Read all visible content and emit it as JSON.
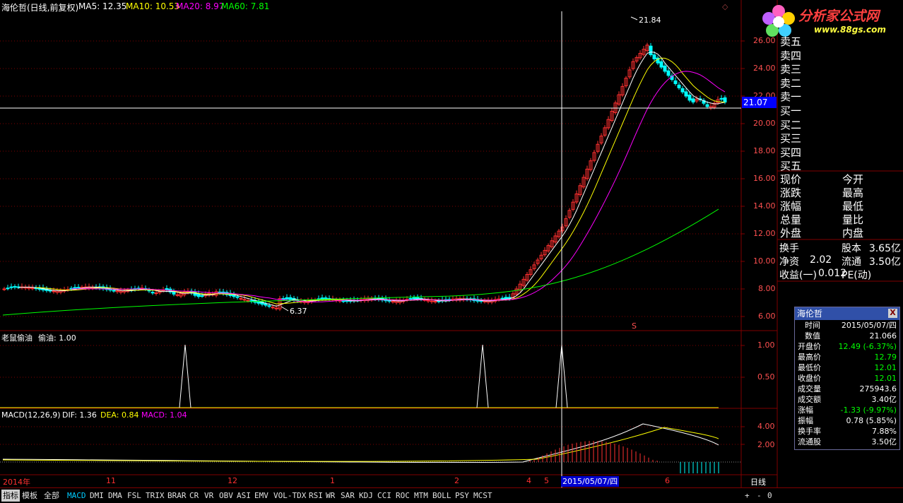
{
  "header": {
    "stock_title": "海伦哲(日线,前复权)",
    "ma5": "MA5: 12.35",
    "ma10": "MA10: 10.53",
    "ma20": "MA20: 8.97",
    "ma60": "MA60: 7.81"
  },
  "logo": {
    "text": "分析家公式网",
    "url": "www.88gs.com"
  },
  "price_axis": [
    "26.00",
    "24.00",
    "22.00",
    "20.00",
    "18.00",
    "16.00",
    "14.00",
    "12.00",
    "10.00",
    "8.00",
    "6.00"
  ],
  "current_price_label": "21.07",
  "annotations": {
    "high_label": "21.84",
    "low_label": "6.37",
    "s_marker": "S"
  },
  "indicator1": {
    "title": "老鼠偷油",
    "value": "偷油: 1.00",
    "axis": [
      "1.00",
      "0.50"
    ]
  },
  "macd": {
    "title": "MACD(12,26,9)",
    "dif": "DIF: 1.36",
    "dea": "DEA: 0.84",
    "macd": "MACD: 1.04",
    "axis": [
      "4.00",
      "2.00"
    ]
  },
  "date_axis": {
    "labels": [
      {
        "text": "2014年",
        "color": "#ff3030"
      },
      {
        "text": "11",
        "color": "#ff3030"
      },
      {
        "text": "12",
        "color": "#ff3030"
      },
      {
        "text": "1",
        "color": "#ff3030"
      },
      {
        "text": "2",
        "color": "#ff3030"
      },
      {
        "text": "4",
        "color": "#ff3030"
      },
      {
        "text": "5",
        "color": "#ff3030"
      },
      {
        "text": "6",
        "color": "#ff3030"
      }
    ],
    "cursor_date": "2015/05/07/四",
    "period": "日线"
  },
  "order_book": {
    "sell": [
      "卖五",
      "卖四",
      "卖三",
      "卖二",
      "卖一"
    ],
    "buy": [
      "买一",
      "买二",
      "买三",
      "买四",
      "买五"
    ]
  },
  "quote": {
    "rows": [
      [
        "现价",
        "今开"
      ],
      [
        "涨跌",
        "最高"
      ],
      [
        "涨幅",
        "最低"
      ],
      [
        "总量",
        "量比"
      ],
      [
        "外盘",
        "内盘"
      ]
    ]
  },
  "stats": {
    "turnover_label": "换手",
    "share_capital_label": "股本",
    "share_capital_value": "3.65亿",
    "net_asset_label": "净资",
    "net_asset_value": "2.02",
    "float_label": "流通",
    "float_value": "3.50亿",
    "eps_label": "收益(一)",
    "eps_value": "0.012",
    "pe_label": "PE(动)"
  },
  "info_panel": {
    "title": "海伦哲",
    "close": "X",
    "rows": [
      {
        "k": "时间",
        "v": "2015/05/07/四",
        "color": "#ffffff"
      },
      {
        "k": "数值",
        "v": "21.066",
        "color": "#ffffff"
      },
      {
        "k": "开盘价",
        "v": "12.49 (-6.37%)",
        "color": "#00ff00"
      },
      {
        "k": "最高价",
        "v": "12.79",
        "color": "#00ff00"
      },
      {
        "k": "最低价",
        "v": "12.01",
        "color": "#00ff00"
      },
      {
        "k": "收盘价",
        "v": "12.01",
        "color": "#00ff00"
      },
      {
        "k": "成交量",
        "v": "275943.6",
        "color": "#ffffff"
      },
      {
        "k": "成交额",
        "v": "3.40亿",
        "color": "#ffffff"
      },
      {
        "k": "涨幅",
        "v": "-1.33 (-9.97%)",
        "color": "#00ff00"
      },
      {
        "k": "振幅",
        "v": "0.78 (5.85%)",
        "color": "#ffffff"
      },
      {
        "k": "换手率",
        "v": "7.88%",
        "color": "#ffffff"
      },
      {
        "k": "流通股",
        "v": "3.50亿",
        "color": "#ffffff"
      }
    ]
  },
  "bottom_tabs": [
    "指标",
    "模板",
    "全部",
    "MACD",
    "DMI",
    "DMA",
    "FSL",
    "TRIX",
    "BRAR",
    "CR",
    "VR",
    "OBV",
    "ASI",
    "EMV",
    "VOL-TDX",
    "RSI",
    "WR",
    "SAR",
    "KDJ",
    "CCI",
    "ROC",
    "MTM",
    "BOLL",
    "PSY",
    "MCST"
  ],
  "bottom_controls": [
    "+",
    "-",
    "0"
  ],
  "colors": {
    "up": "#ff3030",
    "down": "#00ffff",
    "ma5": "#ffffff",
    "ma10": "#ffff00",
    "ma20": "#ff00ff",
    "ma60": "#00ff00",
    "grid": "#800000"
  }
}
